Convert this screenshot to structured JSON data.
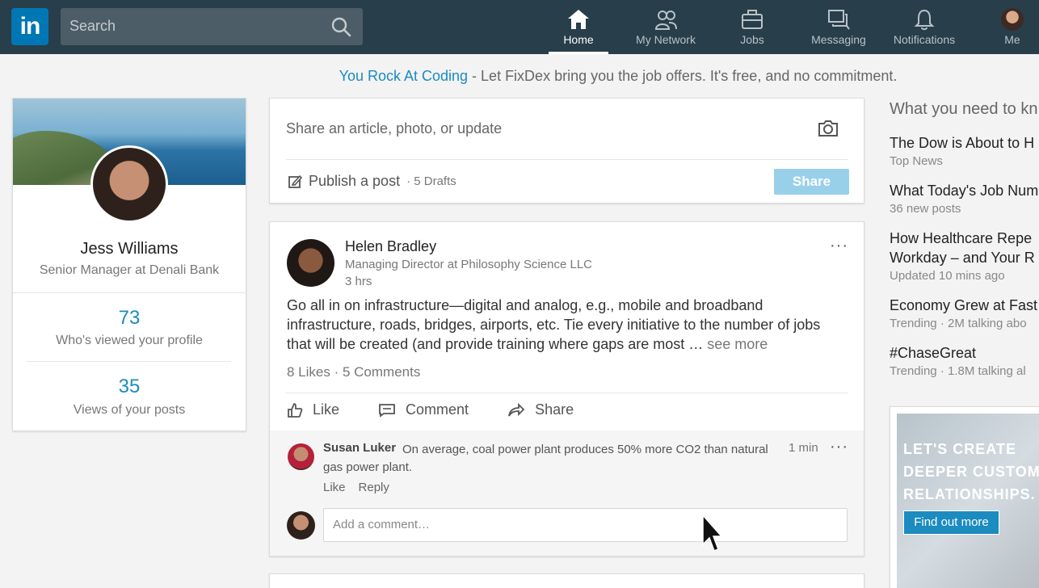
{
  "nav": {
    "search_placeholder": "Search",
    "items": [
      {
        "label": "Home",
        "icon": "home-icon"
      },
      {
        "label": "My Network",
        "icon": "network-icon"
      },
      {
        "label": "Jobs",
        "icon": "briefcase-icon"
      },
      {
        "label": "Messaging",
        "icon": "messaging-icon"
      },
      {
        "label": "Notifications",
        "icon": "bell-icon"
      },
      {
        "label": "Me",
        "icon": "avatar"
      }
    ],
    "active": "Home",
    "logo_text": "in"
  },
  "promo": {
    "highlight": "You Rock At Coding",
    "text": " - Let FixDex bring you the job offers. It's free, and no commitment."
  },
  "profile": {
    "name": "Jess Williams",
    "title": "Senior Manager at Denali Bank",
    "views_count": "73",
    "views_label": "Who's viewed your profile",
    "post_views_count": "35",
    "post_views_label": "Views of your posts"
  },
  "share_box": {
    "placeholder": "Share an article, photo, or update",
    "publish_label": "Publish a post",
    "drafts": "· 5 Drafts",
    "share_button": "Share"
  },
  "post": {
    "author": "Helen Bradley",
    "author_title": "Managing Director at Philosophy Science LLC",
    "time": "3 hrs",
    "body": "Go all in on infrastructure—digital and analog, e.g., mobile and broadband infrastructure, roads, bridges, airports, etc. Tie every initiative to the number of jobs that will be created (and provide training where gaps are most …",
    "see_more": " see more",
    "stats": "8 Likes · 5 Comments",
    "actions": {
      "like": "Like",
      "comment": "Comment",
      "share": "Share"
    },
    "comment": {
      "author": "Susan Luker",
      "text": "On average, coal power plant produces 50% more CO2 than natural gas power plant.",
      "time": "1 min",
      "like": "Like",
      "reply": "Reply"
    },
    "add_comment_placeholder": "Add a comment…"
  },
  "news": {
    "heading": "What you need to kn",
    "items": [
      {
        "title": "The Dow is About to H",
        "sub": "Top News"
      },
      {
        "title": "What Today's Job Num",
        "sub": "36 new posts"
      },
      {
        "title": "How Healthcare Repe",
        "title2": "Workday – and Your R",
        "sub": "Updated 10 mins ago"
      },
      {
        "title": "Economy Grew at Fast",
        "sub": "Trending  ·  2M talking abo"
      },
      {
        "title": "#ChaseGreat",
        "sub": "Trending  ·  1.8M talking al"
      }
    ]
  },
  "ad": {
    "line1": "LET'S CREATE",
    "line2": "DEEPER CUSTOM",
    "line3": "RELATIONSHIPS.",
    "button": "Find out more"
  },
  "colors": {
    "topbar": "#283e4a",
    "brand": "#0077b5",
    "link": "#1b8bc0"
  }
}
